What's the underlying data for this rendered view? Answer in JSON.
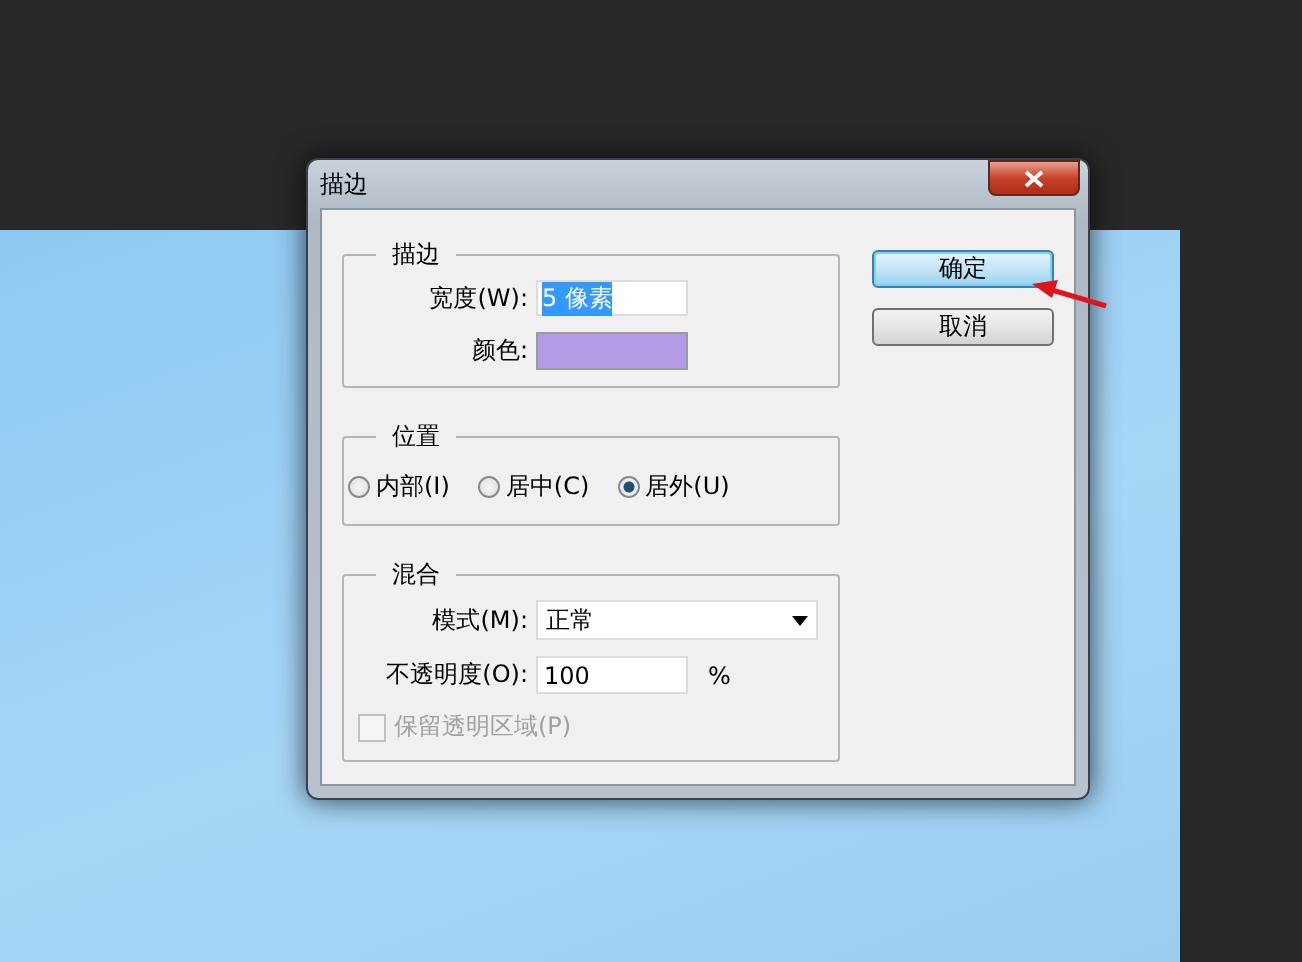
{
  "window": {
    "title": "描边"
  },
  "stroke": {
    "title": "描边",
    "width_label": "宽度(W):",
    "width_value": "5 像素",
    "width_value_selected": true,
    "color_label": "颜色:",
    "color": "#b59ae6"
  },
  "position": {
    "title": "位置",
    "options": [
      {
        "label": "内部(I)",
        "selected": false
      },
      {
        "label": "居中(C)",
        "selected": false
      },
      {
        "label": "居外(U)",
        "selected": true
      }
    ]
  },
  "blend": {
    "title": "混合",
    "mode_label": "模式(M):",
    "mode_value": "正常",
    "opacity_label": "不透明度(O):",
    "opacity_value": "100",
    "opacity_unit": "%",
    "preserve": {
      "label": "保留透明区域(P)",
      "checked": false,
      "disabled": true
    }
  },
  "buttons": [
    {
      "label": "确定",
      "default": true
    },
    {
      "label": "取消",
      "default": false
    }
  ]
}
